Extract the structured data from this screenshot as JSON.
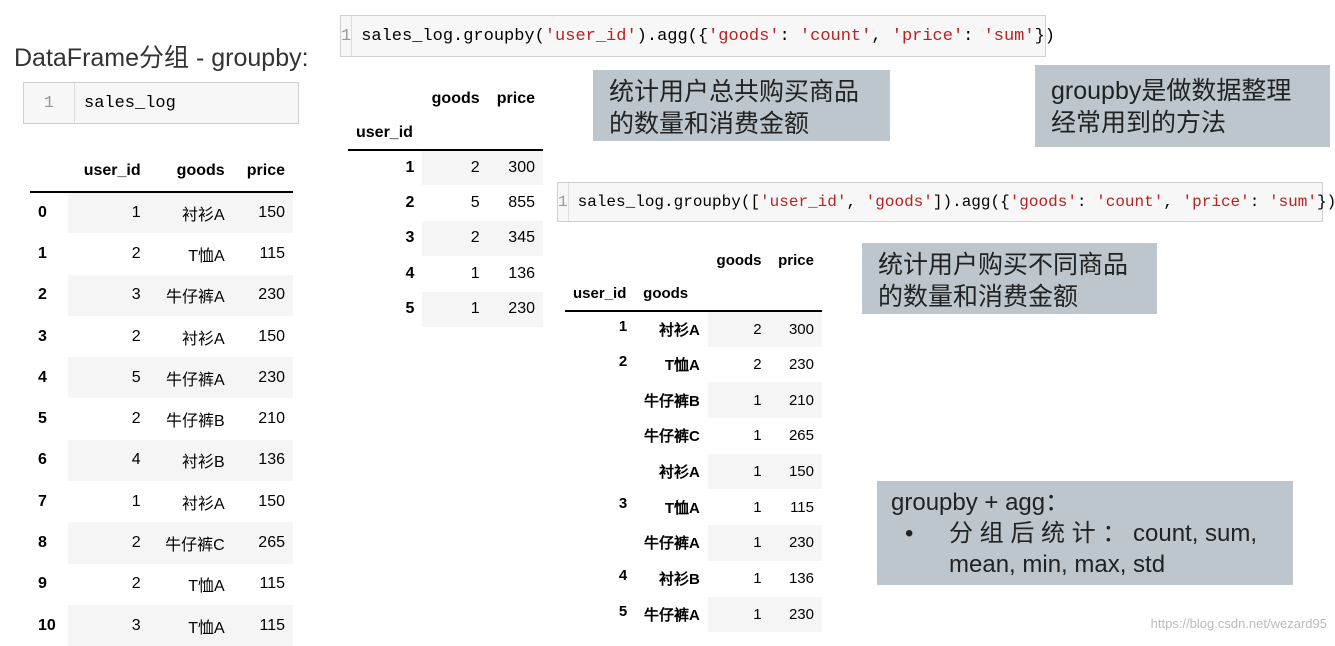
{
  "title": "DataFrame分组 - groupby:",
  "cell1": {
    "line": "1",
    "code": "sales_log"
  },
  "cell2": {
    "line": "1",
    "code_parts": [
      "sales_log.groupby(",
      "'user_id'",
      ").agg({",
      "'goods'",
      ": ",
      "'count'",
      ", ",
      "'price'",
      ": ",
      "'sum'",
      "})"
    ]
  },
  "cell3": {
    "line": "1",
    "code_parts": [
      "sales_log.groupby([",
      "'user_id'",
      ", ",
      "'goods'",
      "]).agg({",
      "'goods'",
      ": ",
      "'count'",
      ", ",
      "'price'",
      ": ",
      "'sum'",
      "})"
    ]
  },
  "table1": {
    "headers": [
      "",
      "user_id",
      "goods",
      "price"
    ],
    "rows": [
      [
        "0",
        "1",
        "衬衫A",
        "150"
      ],
      [
        "1",
        "2",
        "T恤A",
        "115"
      ],
      [
        "2",
        "3",
        "牛仔裤A",
        "230"
      ],
      [
        "3",
        "2",
        "衬衫A",
        "150"
      ],
      [
        "4",
        "5",
        "牛仔裤A",
        "230"
      ],
      [
        "5",
        "2",
        "牛仔裤B",
        "210"
      ],
      [
        "6",
        "4",
        "衬衫B",
        "136"
      ],
      [
        "7",
        "1",
        "衬衫A",
        "150"
      ],
      [
        "8",
        "2",
        "牛仔裤C",
        "265"
      ],
      [
        "9",
        "2",
        "T恤A",
        "115"
      ],
      [
        "10",
        "3",
        "T恤A",
        "115"
      ]
    ]
  },
  "table2": {
    "headers": [
      "goods",
      "price"
    ],
    "index_name": "user_id",
    "rows": [
      [
        "1",
        "2",
        "300"
      ],
      [
        "2",
        "5",
        "855"
      ],
      [
        "3",
        "2",
        "345"
      ],
      [
        "4",
        "1",
        "136"
      ],
      [
        "5",
        "1",
        "230"
      ]
    ]
  },
  "table3": {
    "headers": [
      "goods",
      "price"
    ],
    "index_names": [
      "user_id",
      "goods"
    ],
    "rows": [
      [
        "1",
        "衬衫A",
        "2",
        "300"
      ],
      [
        "2",
        "T恤A",
        "2",
        "230"
      ],
      [
        "",
        "牛仔裤B",
        "1",
        "210"
      ],
      [
        "",
        "牛仔裤C",
        "1",
        "265"
      ],
      [
        "",
        "衬衫A",
        "1",
        "150"
      ],
      [
        "3",
        "T恤A",
        "1",
        "115"
      ],
      [
        "",
        "牛仔裤A",
        "1",
        "230"
      ],
      [
        "4",
        "衬衫B",
        "1",
        "136"
      ],
      [
        "5",
        "牛仔裤A",
        "1",
        "230"
      ]
    ]
  },
  "notes": {
    "n1": [
      "统计用户总共购买商品",
      "的数量和消费金额"
    ],
    "n2": [
      "groupby是做数据整理",
      "经常用到的方法"
    ],
    "n3": [
      "统计用户购买不同商品",
      "的数量和消费金额"
    ],
    "n4": {
      "title": "groupby + agg：",
      "bullet": "•",
      "text1": "分 组 后 统 计 ： count,  sum,",
      "text2": "mean, min, max, std"
    }
  },
  "watermark": "https://blog.csdn.net/wezard95",
  "colors": {
    "note_bg": "#bcc6cc",
    "string": "#ba2121"
  }
}
